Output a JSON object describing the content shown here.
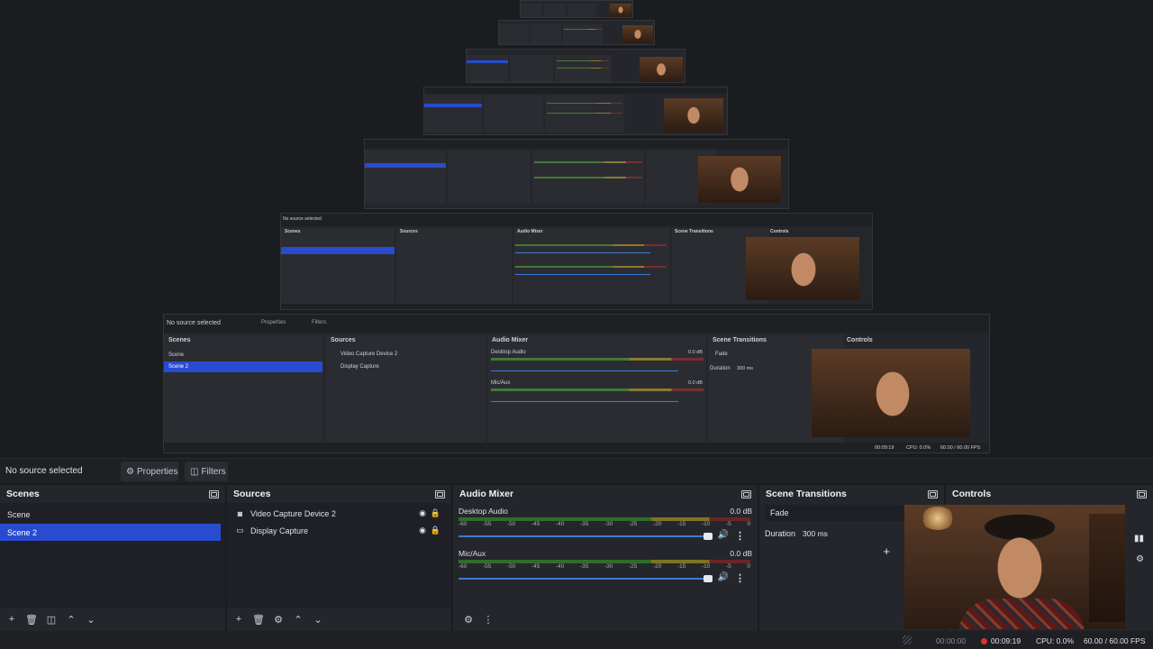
{
  "top": {
    "selection_label": "No source selected",
    "properties_label": "Properties",
    "filters_label": "Filters"
  },
  "scenes": {
    "title": "Scenes",
    "items": [
      {
        "label": "Scene",
        "selected": false
      },
      {
        "label": "Scene 2",
        "selected": true
      }
    ]
  },
  "sources": {
    "title": "Sources",
    "items": [
      {
        "label": "Video Capture Device 2",
        "icon": "camera-icon"
      },
      {
        "label": "Display Capture",
        "icon": "monitor-icon"
      }
    ]
  },
  "audio_mixer": {
    "title": "Audio Mixer",
    "ticks": [
      "-60",
      "-55",
      "-50",
      "-45",
      "-40",
      "-35",
      "-30",
      "-25",
      "-20",
      "-15",
      "-10",
      "-5",
      "0"
    ],
    "channels": [
      {
        "name": "Desktop Audio",
        "db": "0.0 dB",
        "level": 0.0
      },
      {
        "name": "Mic/Aux",
        "db": "0.0 dB",
        "level": 0.0
      }
    ]
  },
  "scene_transitions": {
    "title": "Scene Transitions",
    "transition": "Fade",
    "duration_label": "Duration",
    "duration_value": "300 ms"
  },
  "controls": {
    "title": "Controls"
  },
  "status": {
    "stream_time": "00:00:00",
    "rec_time": "00:09:19",
    "cpu": "CPU: 0.0%",
    "fps": "60.00 / 60.00 FPS"
  },
  "nested_preview": {
    "selection_label": "No source selected",
    "properties_label": "Properties",
    "filters_label": "Filters",
    "scenes_title": "Scenes",
    "sources_title": "Sources",
    "mixer_title": "Audio Mixer",
    "transitions_title": "Scene Transitions",
    "controls_title": "Controls",
    "scene_1": "Scene",
    "scene_2": "Scene 2",
    "source_1": "Video Capture Device 2",
    "source_2": "Display Capture",
    "channel_1": "Desktop Audio",
    "channel_2": "Mic/Aux",
    "db": "0.0 dB",
    "fade": "Fade",
    "duration_label": "Duration",
    "duration_value": "300 ms",
    "stream_time": "00:00:00",
    "rec_time": "00:09:19",
    "cpu": "CPU: 0.0%",
    "fps": "60.00 / 60.00 FPS"
  }
}
